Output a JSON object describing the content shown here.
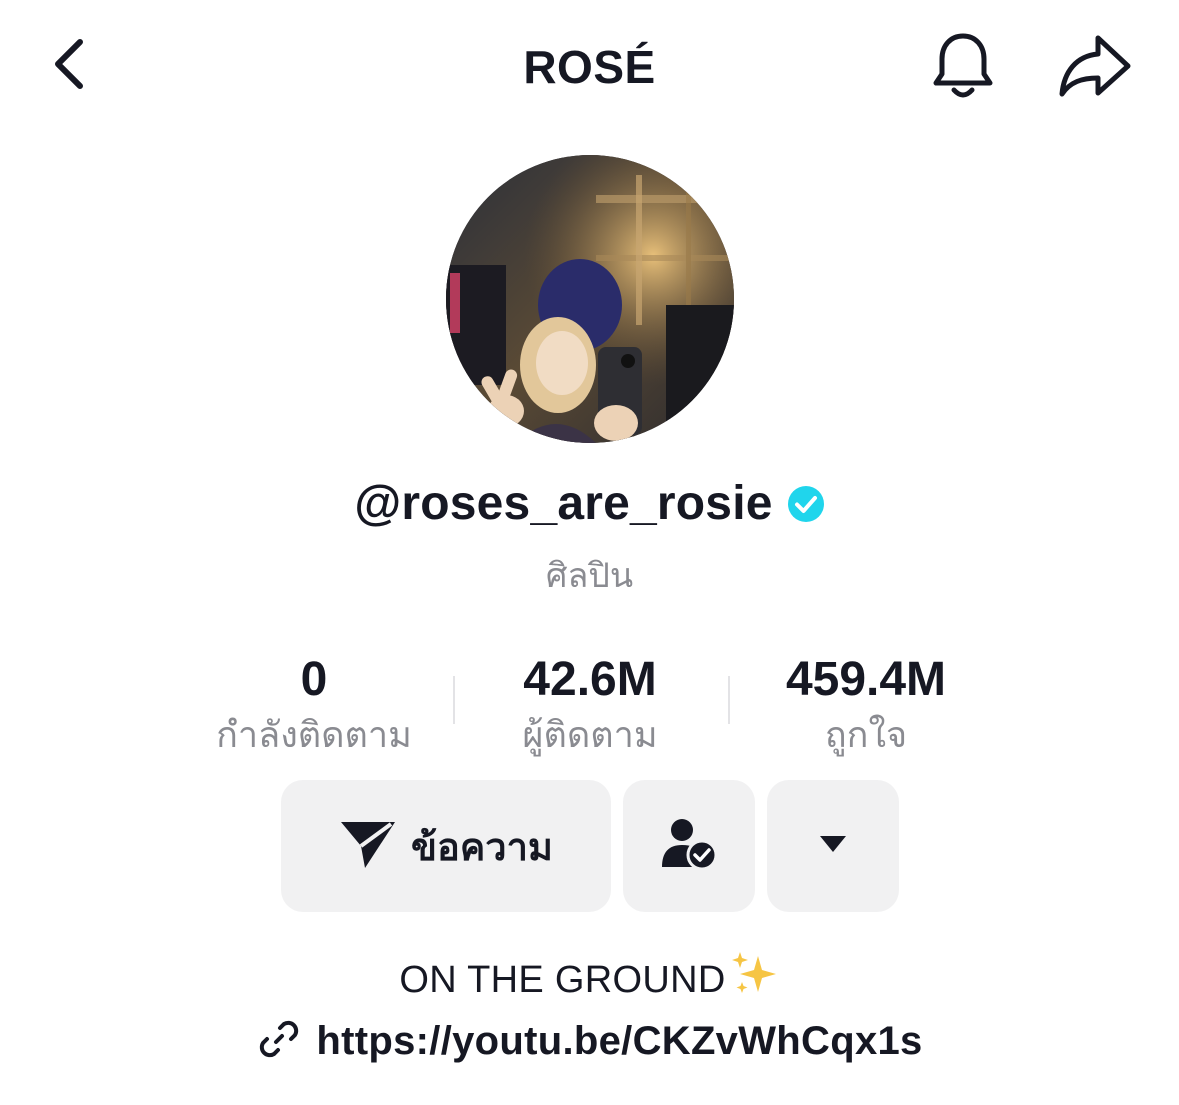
{
  "header": {
    "title": "ROSÉ",
    "back_icon": "chevron-left-icon",
    "bell_icon": "bell-icon",
    "share_icon": "share-icon"
  },
  "profile": {
    "username": "@roses_are_rosie",
    "verified": true,
    "verified_color": "#20D5EC",
    "category": "ศิลปิน"
  },
  "stats": {
    "following": {
      "value": "0",
      "label": "กำลังติดตาม"
    },
    "followers": {
      "value": "42.6M",
      "label": "ผู้ติดตาม"
    },
    "likes": {
      "value": "459.4M",
      "label": "ถูกใจ"
    }
  },
  "actions": {
    "message_label": "ข้อความ",
    "message_icon": "send-icon",
    "friends_icon": "user-check-icon",
    "more_icon": "caret-down-icon"
  },
  "bio": {
    "text": "ON THE GROUND",
    "emoji": "sparkles-icon",
    "link": "https://youtu.be/CKZvWhCqx1s",
    "link_icon": "link-icon"
  },
  "colors": {
    "text": "#161823",
    "secondary": "#8A8B91",
    "button_bg": "#F1F1F2"
  }
}
